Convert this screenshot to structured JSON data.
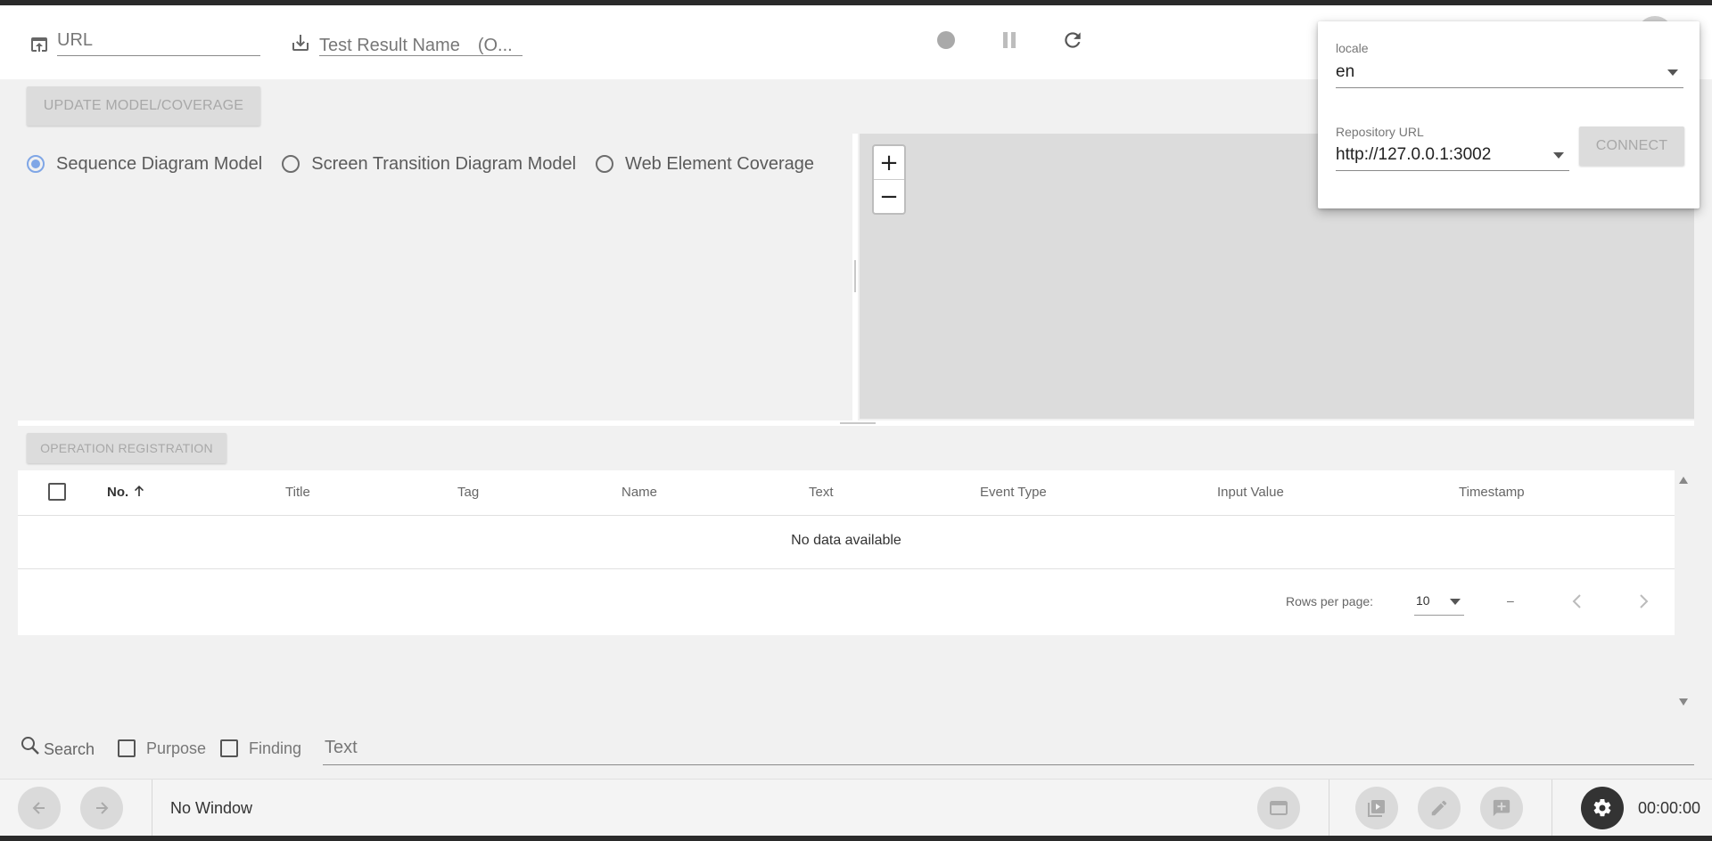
{
  "header": {
    "url_placeholder": "URL",
    "test_result_placeholder": "Test Result Name　(O..."
  },
  "toolbar": {
    "update_model_label": "UPDATE MODEL/COVERAGE",
    "operation_registration_label": "OPERATION REGISTRATION"
  },
  "model_options": [
    {
      "label": "Sequence Diagram Model",
      "selected": true
    },
    {
      "label": "Screen Transition Diagram Model",
      "selected": false
    },
    {
      "label": "Web Element Coverage",
      "selected": false
    }
  ],
  "zoom": {
    "in": "+",
    "out": "−"
  },
  "table": {
    "columns": [
      "No.",
      "Title",
      "Tag",
      "Name",
      "Text",
      "Event Type",
      "Input Value",
      "Timestamp"
    ],
    "empty_text": "No data available",
    "rows_per_page_label": "Rows per page:",
    "rows_per_page_value": "10",
    "page_range": "–"
  },
  "search": {
    "label": "Search",
    "purpose_label": "Purpose",
    "finding_label": "Finding",
    "text_placeholder": "Text"
  },
  "footer": {
    "window_label": "No Window",
    "timer": "00:00:00"
  },
  "settings_popover": {
    "locale_label": "locale",
    "locale_value": "en",
    "repo_label": "Repository URL",
    "repo_value": "http://127.0.0.1:3002",
    "connect_label": "CONNECT"
  },
  "colors": {
    "accent_radio": "#7fa6e6",
    "settings_button": "#333333",
    "diagram_background": "#dcdcdc"
  }
}
